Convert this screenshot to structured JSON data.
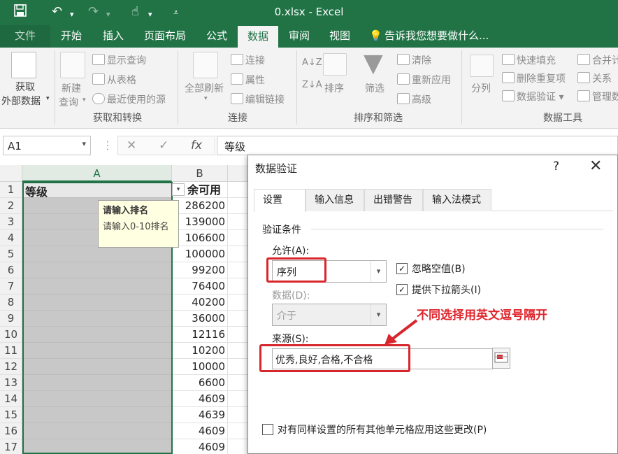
{
  "app": {
    "title": "0.xlsx - Excel",
    "quick_access": [
      "save-icon",
      "undo-icon",
      "redo-icon",
      "touch-mode-icon",
      "customize-icon"
    ]
  },
  "tabs": [
    {
      "label": "文件"
    },
    {
      "label": "开始"
    },
    {
      "label": "插入"
    },
    {
      "label": "页面布局"
    },
    {
      "label": "公式"
    },
    {
      "label": "数据",
      "active": true
    },
    {
      "label": "审阅"
    },
    {
      "label": "视图"
    },
    {
      "label": "告诉我您想要做什么..."
    }
  ],
  "ribbon": {
    "get_external": "获取\n外部数据",
    "get_external_line1": "获取",
    "get_external_line2": "外部数据",
    "new_query_line1": "新建",
    "new_query_line2": "查询",
    "show_query": "显示查询",
    "from_table": "从表格",
    "recent_sources": "最近使用的源",
    "group_get_transform": "获取和转换",
    "refresh_all": "全部刷新",
    "connections": "连接",
    "properties": "属性",
    "edit_links": "编辑链接",
    "group_connections": "连接",
    "sort": "排序",
    "filter": "筛选",
    "clear": "清除",
    "reapply": "重新应用",
    "advanced": "高级",
    "group_sort_filter": "排序和筛选",
    "text_to_columns": "分列",
    "flash_fill": "快速填充",
    "remove_duplicates": "删除重复项",
    "data_validation": "数据验证",
    "consolidate": "合并计",
    "relationships": "关系",
    "manage": "管理数",
    "group_data_tools": "数据工具"
  },
  "formula_bar": {
    "name_box": "A1",
    "fx": "fx",
    "value": "等级"
  },
  "sheet": {
    "columns": [
      "A",
      "B"
    ],
    "header_a": "等级",
    "header_b": "余可用",
    "rows": [
      {
        "n": "1"
      },
      {
        "n": "2",
        "b": "286200"
      },
      {
        "n": "3",
        "b": "139000"
      },
      {
        "n": "4",
        "b": "106600"
      },
      {
        "n": "5",
        "b": "100000"
      },
      {
        "n": "6",
        "b": "99200"
      },
      {
        "n": "7",
        "b": "76400"
      },
      {
        "n": "8",
        "b": "40200"
      },
      {
        "n": "9",
        "b": "36000"
      },
      {
        "n": "10",
        "b": "12116"
      },
      {
        "n": "11",
        "b": "10200"
      },
      {
        "n": "12",
        "b": "10000"
      },
      {
        "n": "13",
        "b": "6600"
      },
      {
        "n": "14",
        "b": "4609"
      },
      {
        "n": "15",
        "b": "4639"
      },
      {
        "n": "16",
        "b": "4609"
      },
      {
        "n": "17",
        "b": "4609"
      }
    ],
    "tooltip_title": "请输入排名",
    "tooltip_body": "请输入0-10排名"
  },
  "dialog": {
    "title": "数据验证",
    "help": "?",
    "close": "✕",
    "tabs": [
      "设置",
      "输入信息",
      "出错警告",
      "输入法模式"
    ],
    "section": "验证条件",
    "allow_label": "允许(A):",
    "allow_value": "序列",
    "ignore_blank": "忽略空值(B)",
    "dropdown": "提供下拉箭头(I)",
    "data_label": "数据(D):",
    "data_value": "介于",
    "source_label": "来源(S):",
    "source_value": "优秀,良好,合格,不合格",
    "apply_all": "对有同样设置的所有其他单元格应用这些更改(P)"
  },
  "annotation": {
    "text": "不同选择用英文逗号隔开",
    "color": "#e0242b"
  },
  "colors": {
    "excel_green": "#217346",
    "highlight_red": "#d8262d"
  }
}
